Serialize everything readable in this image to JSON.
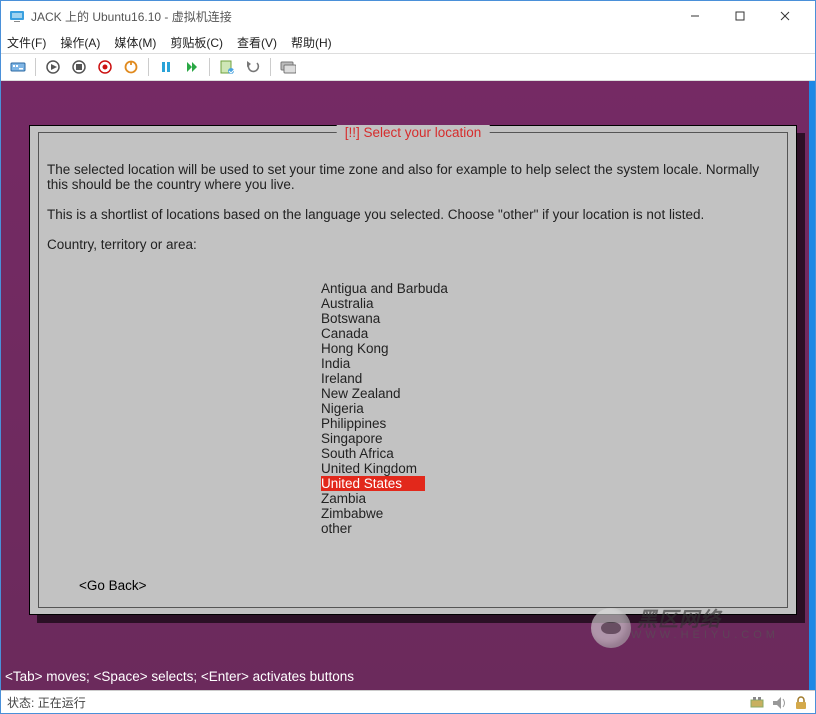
{
  "window": {
    "title": "JACK 上的 Ubuntu16.10 - 虚拟机连接"
  },
  "menu": {
    "file": "文件(F)",
    "action": "操作(A)",
    "media": "媒体(M)",
    "clip": "剪贴板(C)",
    "view": "查看(V)",
    "help": "帮助(H)"
  },
  "dialog": {
    "title": "[!!] Select your location",
    "para1": "The selected location will be used to set your time zone and also for example to help select the system locale. Normally this should be the country where you live.",
    "para2": "This is a shortlist of locations based on the language you selected. Choose \"other\" if your location is not listed.",
    "prompt": "Country, territory or area:",
    "options": [
      "Antigua and Barbuda",
      "Australia",
      "Botswana",
      "Canada",
      "Hong Kong",
      "India",
      "Ireland",
      "New Zealand",
      "Nigeria",
      "Philippines",
      "Singapore",
      "South Africa",
      "United Kingdom",
      "United States",
      "Zambia",
      "Zimbabwe",
      "other"
    ],
    "selected_index": 13,
    "goback": "<Go Back>"
  },
  "tui_hint": "<Tab> moves; <Space> selects; <Enter> activates buttons",
  "status": {
    "label": "状态:",
    "value": "正在运行"
  },
  "watermark": {
    "text": "黑区网络"
  }
}
